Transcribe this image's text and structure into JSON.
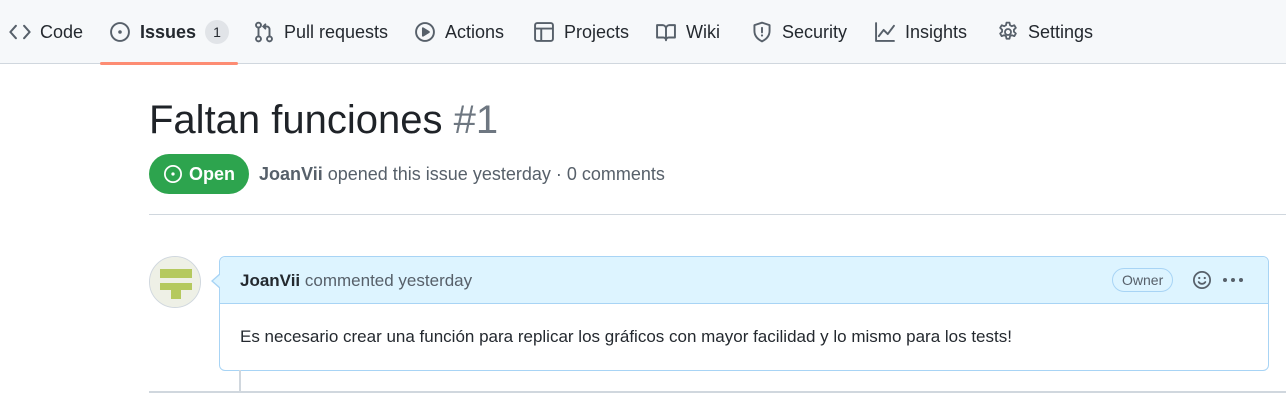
{
  "tabs": [
    {
      "label": "Code",
      "icon": "code-icon"
    },
    {
      "label": "Issues",
      "icon": "issue-opened-icon",
      "counter": "1",
      "selected": true
    },
    {
      "label": "Pull requests",
      "icon": "git-pull-request-icon"
    },
    {
      "label": "Actions",
      "icon": "play-icon"
    },
    {
      "label": "Projects",
      "icon": "table-icon"
    },
    {
      "label": "Wiki",
      "icon": "book-icon"
    },
    {
      "label": "Security",
      "icon": "shield-icon"
    },
    {
      "label": "Insights",
      "icon": "graph-icon"
    },
    {
      "label": "Settings",
      "icon": "gear-icon"
    }
  ],
  "issue": {
    "title": "Faltan funciones",
    "number": "#1",
    "state": "Open",
    "author": "JoanVii",
    "meta_text": "opened this issue yesterday · 0 comments"
  },
  "comment": {
    "author": "JoanVii",
    "action": "commented yesterday",
    "role_badge": "Owner",
    "body": "Es necesario crear una función para replicar los gráficos con mayor facilidad y lo mismo para los tests!"
  },
  "colors": {
    "accent_underline": "#fd8c73",
    "open_state": "#2da44e",
    "comment_header_bg": "#ddf4ff"
  }
}
